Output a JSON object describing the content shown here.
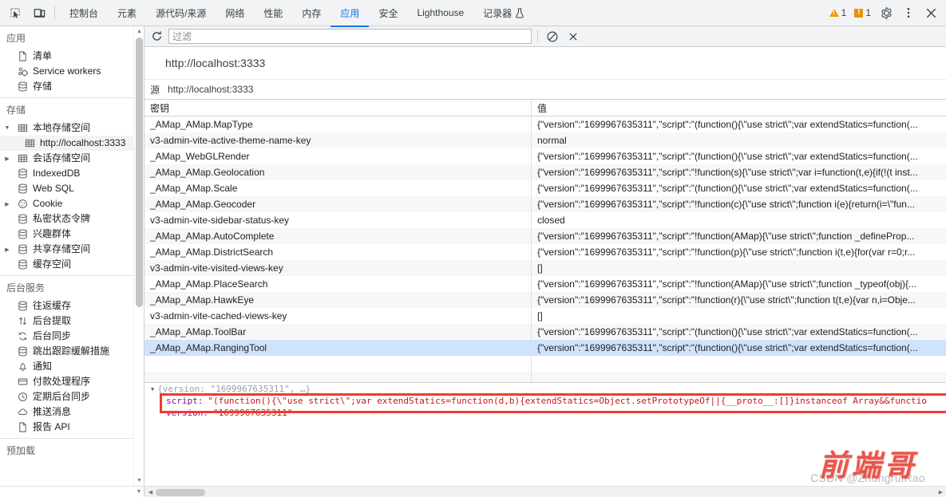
{
  "toolbar": {
    "inspect_icon": "inspect-cursor-icon",
    "device_icon": "device-toolbar-icon",
    "tabs": [
      {
        "label": "控制台",
        "selected": false
      },
      {
        "label": "元素",
        "selected": false
      },
      {
        "label": "源代码/来源",
        "selected": false
      },
      {
        "label": "网络",
        "selected": false
      },
      {
        "label": "性能",
        "selected": false
      },
      {
        "label": "内存",
        "selected": false
      },
      {
        "label": "应用",
        "selected": true
      },
      {
        "label": "安全",
        "selected": false
      },
      {
        "label": "Lighthouse",
        "selected": false
      },
      {
        "label": "记录器",
        "selected": false
      }
    ],
    "warning_count": "1",
    "error_count": "1",
    "settings_icon": "gear-icon",
    "more_icon": "more-vertical-icon",
    "close_icon": "close-icon",
    "accent_color": "#1a73e8"
  },
  "sidebar": {
    "section_application": "应用",
    "application_items": [
      {
        "label": "清单",
        "icon": "manifest-file-icon",
        "arrow": "none"
      },
      {
        "label": "Service workers",
        "icon": "service-worker-icon",
        "arrow": "none"
      },
      {
        "label": "存储",
        "icon": "database-icon",
        "arrow": "none"
      }
    ],
    "section_storage": "存储",
    "storage_items": [
      {
        "label": "本地存储空间",
        "icon": "table-grid-icon",
        "arrow": "expanded",
        "level": 1,
        "selected": false
      },
      {
        "label": "http://localhost:3333",
        "icon": "table-grid-icon",
        "arrow": "none",
        "level": 2,
        "selected": true
      },
      {
        "label": "会话存储空间",
        "icon": "table-grid-icon",
        "arrow": "collapsed",
        "level": 1,
        "selected": false
      },
      {
        "label": "IndexedDB",
        "icon": "database-icon",
        "arrow": "none",
        "level": 1,
        "selected": false
      },
      {
        "label": "Web SQL",
        "icon": "database-icon",
        "arrow": "none",
        "level": 1,
        "selected": false
      },
      {
        "label": "Cookie",
        "icon": "cookie-icon",
        "arrow": "collapsed",
        "level": 1,
        "selected": false
      },
      {
        "label": "私密状态令牌",
        "icon": "database-icon",
        "arrow": "none",
        "level": 1,
        "selected": false
      },
      {
        "label": "兴趣群体",
        "icon": "database-icon",
        "arrow": "none",
        "level": 1,
        "selected": false
      },
      {
        "label": "共享存储空间",
        "icon": "database-icon",
        "arrow": "collapsed",
        "level": 1,
        "selected": false
      },
      {
        "label": "缓存空间",
        "icon": "database-icon",
        "arrow": "none",
        "level": 1,
        "selected": false
      }
    ],
    "section_background": "后台服务",
    "background_items": [
      {
        "label": "往返缓存",
        "icon": "database-icon"
      },
      {
        "label": "后台提取",
        "icon": "arrows-updown-icon"
      },
      {
        "label": "后台同步",
        "icon": "sync-icon"
      },
      {
        "label": "跳出跟踪缓解措施",
        "icon": "database-icon"
      },
      {
        "label": "通知",
        "icon": "bell-icon"
      },
      {
        "label": "付款处理程序",
        "icon": "credit-card-icon"
      },
      {
        "label": "定期后台同步",
        "icon": "clock-icon"
      },
      {
        "label": "推送消息",
        "icon": "cloud-icon"
      },
      {
        "label": "报告 API",
        "icon": "report-file-icon"
      }
    ],
    "section_preload": "预加载"
  },
  "filter_bar": {
    "refresh_icon": "refresh-icon",
    "placeholder": "过滤",
    "value": "",
    "clear_all_icon": "no-entry-icon",
    "delete_icon": "close-icon"
  },
  "origin": {
    "title": "http://localhost:3333",
    "label": "源",
    "url": "http://localhost:3333"
  },
  "table": {
    "columns": [
      "密钥",
      "值"
    ],
    "rows": [
      {
        "key": "_AMap_AMap.MapType",
        "value": "{\"version\":\"1699967635311\",\"script\":\"(function(){\\\"use strict\\\";var extendStatics=function(..."
      },
      {
        "key": "v3-admin-vite-active-theme-name-key",
        "value": "normal"
      },
      {
        "key": "_AMap_WebGLRender",
        "value": "{\"version\":\"1699967635311\",\"script\":\"(function(){\\\"use strict\\\";var extendStatics=function(..."
      },
      {
        "key": "_AMap_AMap.Geolocation",
        "value": "{\"version\":\"1699967635311\",\"script\":\"!function(s){\\\"use strict\\\";var i=function(t,e){if(!(t inst..."
      },
      {
        "key": "_AMap_AMap.Scale",
        "value": "{\"version\":\"1699967635311\",\"script\":\"(function(){\\\"use strict\\\";var extendStatics=function(..."
      },
      {
        "key": "_AMap_AMap.Geocoder",
        "value": "{\"version\":\"1699967635311\",\"script\":\"!function(c){\\\"use strict\\\";function i(e){return(i=\\\"fun..."
      },
      {
        "key": "v3-admin-vite-sidebar-status-key",
        "value": "closed"
      },
      {
        "key": "_AMap_AMap.AutoComplete",
        "value": "{\"version\":\"1699967635311\",\"script\":\"!function(AMap){\\\"use strict\\\";function _defineProp..."
      },
      {
        "key": "_AMap_AMap.DistrictSearch",
        "value": "{\"version\":\"1699967635311\",\"script\":\"!function(p){\\\"use strict\\\";function i(t,e){for(var r=0;r..."
      },
      {
        "key": "v3-admin-vite-visited-views-key",
        "value": "[]"
      },
      {
        "key": "_AMap_AMap.PlaceSearch",
        "value": "{\"version\":\"1699967635311\",\"script\":\"!function(AMap){\\\"use strict\\\";function _typeof(obj){..."
      },
      {
        "key": "_AMap_AMap.HawkEye",
        "value": "{\"version\":\"1699967635311\",\"script\":\"!function(r){\\\"use strict\\\";function t(t,e){var n,i=Obje..."
      },
      {
        "key": "v3-admin-vite-cached-views-key",
        "value": "[]"
      },
      {
        "key": "_AMap_AMap.ToolBar",
        "value": "{\"version\":\"1699967635311\",\"script\":\"(function(){\\\"use strict\\\";var extendStatics=function(..."
      },
      {
        "key": "_AMap_AMap.RangingTool",
        "value": "{\"version\":\"1699967635311\",\"script\":\"(function(){\\\"use strict\\\";var extendStatics=function(...",
        "selected": true
      }
    ]
  },
  "preview": {
    "root_line": "{version: \"1699967635311\", …}",
    "script_key": "script:",
    "script_value": "\"(function(){\\\"use strict\\\";var extendStatics=function(d,b){extendStatics=Object.setPrototypeOf||{__proto__:[]}instanceof Array&&functio",
    "version_key": "version:",
    "version_value": "\"1699967635311\"",
    "highlight_color": "#ef3b2d"
  },
  "watermark": {
    "brand": "前端哥",
    "credit": "CSDN @ZhongruiRao",
    "color": "#e8483c"
  }
}
